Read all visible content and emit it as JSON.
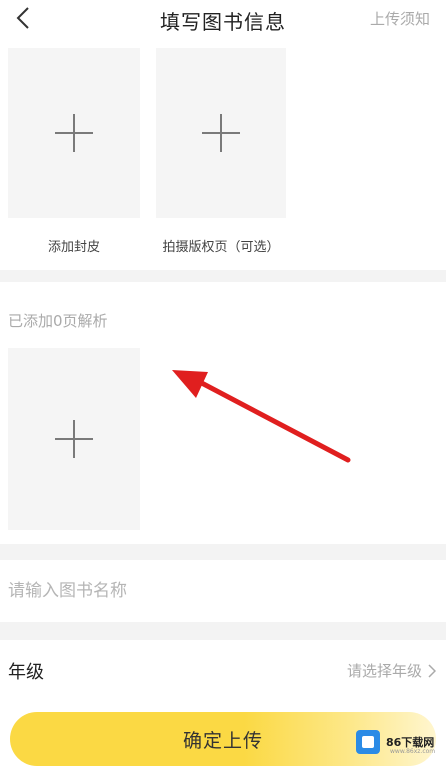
{
  "header": {
    "title": "填写图书信息",
    "notice_link": "上传须知"
  },
  "uploads": {
    "cover_label": "添加封皮",
    "copyright_label": "拍摄版权页（可选）"
  },
  "parse": {
    "count_text": "已添加0页解析"
  },
  "book_name": {
    "value": "",
    "placeholder": "请输入图书名称"
  },
  "grade": {
    "label": "年级",
    "select_placeholder": "请选择年级"
  },
  "submit": {
    "label": "确定上传"
  },
  "watermark": {
    "text": "86下载网",
    "sub": "www.86xz.com"
  },
  "annotation": {
    "arrow_color": "#e01f1f"
  },
  "colors": {
    "accent": "#fbd944",
    "muted_text": "#aaaaaa",
    "tile_bg": "#f5f5f5"
  }
}
